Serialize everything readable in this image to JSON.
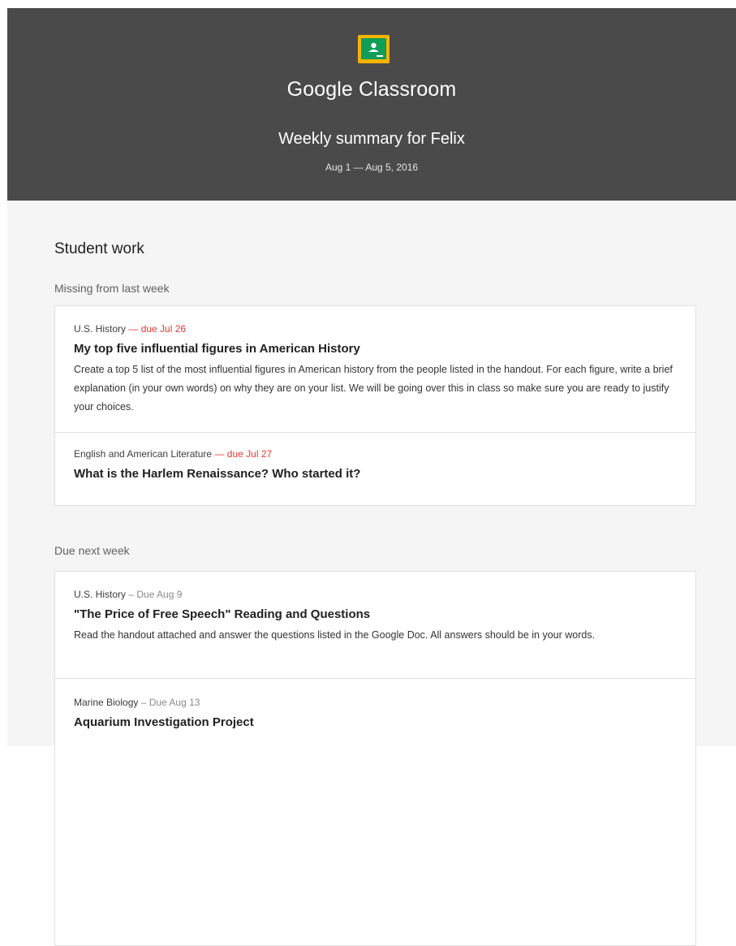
{
  "header": {
    "brand_google": "Google",
    "brand_classroom": "Classroom",
    "title": "Weekly summary for Felix",
    "date_range": "Aug 1 — Aug 5, 2016",
    "logo_colors": {
      "frame": "#f4b400",
      "board": "#0f9d58"
    }
  },
  "main": {
    "section_title": "Student work",
    "missing_label": "Missing from last week",
    "missing": [
      {
        "course": "U.S. History",
        "due": "— due Jul 26",
        "title": "My top five influential figures in American History",
        "description": "Create a top 5 list of the most influential figures in American history from the people listed in the handout. For each figure, write a brief explanation (in your own words) on why they are on your list. We will be going over this in class so make sure you are ready to justify your choices."
      },
      {
        "course": "English and American Literature",
        "due": "— due Jul 27",
        "title": "What is the Harlem Renaissance? Who started it?"
      }
    ],
    "upcoming_label": "Due next week",
    "upcoming": [
      {
        "course": "U.S. History",
        "due": "– Due Aug 9",
        "title": "\"The Price of Free Speech\" Reading and Questions",
        "description": "Read the handout attached and answer the questions listed in the Google Doc. All answers should be in your words."
      },
      {
        "course": "Marine Biology",
        "due": "– Due Aug 13",
        "title": "Aquarium Investigation Project"
      }
    ]
  }
}
